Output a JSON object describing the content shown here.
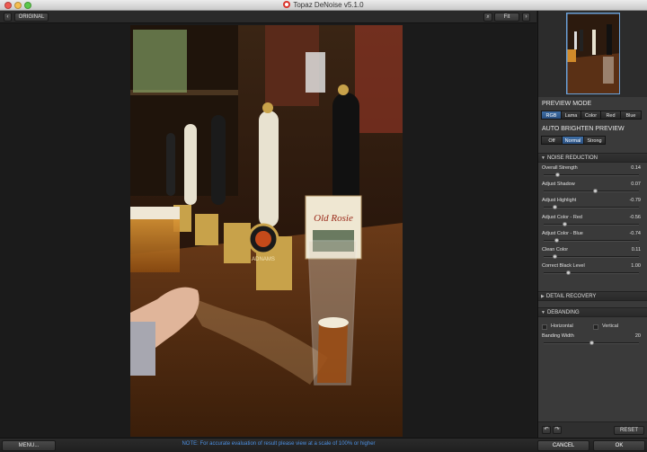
{
  "window": {
    "title": "Topaz DeNoise v5.1.0"
  },
  "toolbar": {
    "original_label": "ORIGINAL",
    "zoom_value": "Fit",
    "left_arrow": "‹",
    "right_arrow": "›",
    "search_glyph": "⌕"
  },
  "preview_mode": {
    "title": "PREVIEW MODE",
    "options": [
      "RGB",
      "Lama",
      "Color",
      "Red",
      "Blue"
    ],
    "selected": "RGB"
  },
  "auto_brighten": {
    "title": "AUTO BRIGHTEN PREVIEW",
    "options": [
      "Off",
      "Normal",
      "Strong"
    ],
    "selected": "Normal"
  },
  "noise_reduction": {
    "title": "NOISE REDUCTION",
    "sliders": [
      {
        "label": "Overall Strength",
        "value": "0.14",
        "pos": 0.14
      },
      {
        "label": "Adjust Shadow",
        "value": "0.07",
        "pos": 0.54
      },
      {
        "label": "Adjust Highlight",
        "value": "-0.79",
        "pos": 0.11
      },
      {
        "label": "Adjust Color - Red",
        "value": "-0.56",
        "pos": 0.22
      },
      {
        "label": "Adjust Color - Blue",
        "value": "-0.74",
        "pos": 0.13
      },
      {
        "label": "Clean Color",
        "value": "0.11",
        "pos": 0.11
      },
      {
        "label": "Correct Black Level",
        "value": "1.00",
        "pos": 0.25
      }
    ]
  },
  "detail_recovery": {
    "title": "DETAIL RECOVERY"
  },
  "debanding": {
    "title": "DEBANDING",
    "horizontal_label": "Horizontal",
    "vertical_label": "Vertical",
    "banding_width_label": "Banding Width",
    "banding_width_value": "20",
    "banding_width_pos": 0.5
  },
  "panel_footer": {
    "undo": "↶",
    "redo": "↷",
    "reset_label": "RESET"
  },
  "status": {
    "menu_label": "MENU...",
    "note": "NOTE:  For accurate evaluation of result please view at a scale of 100% or higher",
    "cancel_label": "CANCEL",
    "ok_label": "OK"
  },
  "photo": {
    "sign_text": "Old Rosie",
    "pump_label": "ADNAMS"
  },
  "colors": {
    "accent": "#3f6fa6",
    "note": "#4c8fe0"
  }
}
